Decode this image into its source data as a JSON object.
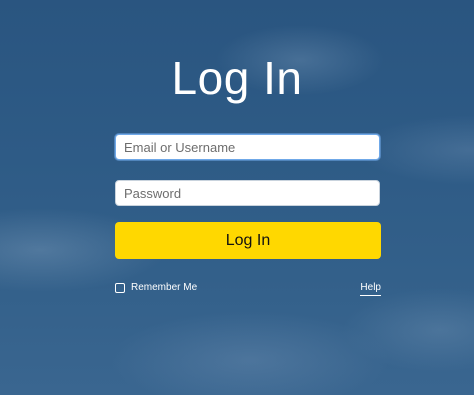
{
  "login": {
    "title": "Log In",
    "email_placeholder": "Email or Username",
    "password_placeholder": "Password",
    "submit_label": "Log In",
    "remember_label": "Remember Me",
    "remember_checked": false,
    "help_label": "Help"
  },
  "colors": {
    "background": "#2b5883",
    "button": "#ffd800",
    "text": "#ffffff"
  }
}
